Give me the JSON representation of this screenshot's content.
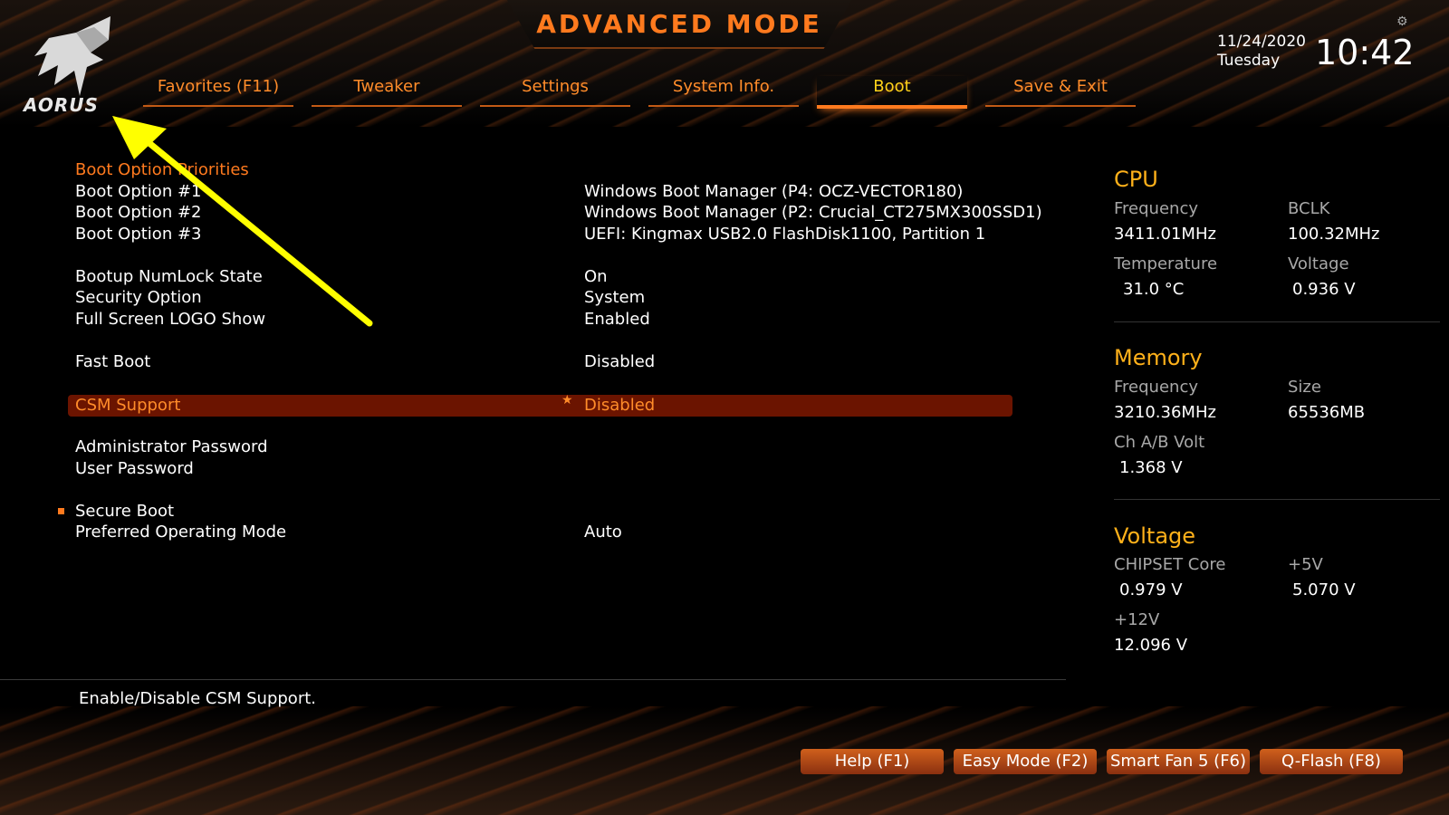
{
  "header": {
    "title": "ADVANCED MODE",
    "logo_text": "AORUS",
    "date": "11/24/2020",
    "day": "Tuesday",
    "time": "10:42"
  },
  "tabs": [
    {
      "label": "Favorites (F11)"
    },
    {
      "label": "Tweaker"
    },
    {
      "label": "Settings"
    },
    {
      "label": "System Info."
    },
    {
      "label": "Boot",
      "active": true
    },
    {
      "label": "Save & Exit"
    }
  ],
  "boot": {
    "priorities_header": "Boot Option Priorities",
    "options": [
      {
        "label": "Boot Option #1",
        "value": "Windows Boot Manager (P4: OCZ-VECTOR180)"
      },
      {
        "label": "Boot Option #2",
        "value": "Windows Boot Manager (P2: Crucial_CT275MX300SSD1)"
      },
      {
        "label": "Boot Option #3",
        "value": "UEFI: Kingmax USB2.0 FlashDisk1100, Partition 1"
      }
    ],
    "numlock": {
      "label": "Bootup NumLock State",
      "value": "On"
    },
    "security": {
      "label": "Security Option",
      "value": "System"
    },
    "logo": {
      "label": "Full Screen LOGO Show",
      "value": "Enabled"
    },
    "fastboot": {
      "label": "Fast Boot",
      "value": "Disabled"
    },
    "csm": {
      "label": "CSM Support",
      "value": "Disabled"
    },
    "admin_pw": {
      "label": "Administrator Password"
    },
    "user_pw": {
      "label": "User Password"
    },
    "secure_boot": {
      "label": "Secure Boot"
    },
    "preferred_os": {
      "label": "Preferred Operating Mode",
      "value": "Auto"
    }
  },
  "help_text": "Enable/Disable CSM Support.",
  "sidebar": {
    "cpu": {
      "title": "CPU",
      "freq_label": "Frequency",
      "freq": "3411.01MHz",
      "bclk_label": "BCLK",
      "bclk": "100.32MHz",
      "temp_label": "Temperature",
      "temp": "31.0 °C",
      "volt_label": "Voltage",
      "volt": "0.936 V"
    },
    "memory": {
      "title": "Memory",
      "freq_label": "Frequency",
      "freq": "3210.36MHz",
      "size_label": "Size",
      "size": "65536MB",
      "chab_label": "Ch A/B Volt",
      "chab": "1.368 V"
    },
    "voltage": {
      "title": "Voltage",
      "chipset_label": "CHIPSET Core",
      "chipset": "0.979 V",
      "p5v_label": "+5V",
      "p5v": "5.070 V",
      "p12v_label": "+12V",
      "p12v": "12.096 V"
    }
  },
  "footer": {
    "help": "Help (F1)",
    "easy": "Easy Mode (F2)",
    "fan": "Smart Fan 5 (F6)",
    "qflash": "Q-Flash (F8)"
  },
  "colors": {
    "accent": "#ff7a1e",
    "active_tab": "#ffd21a",
    "highlight_row": "#6b1400",
    "side_heading": "#ffb11a",
    "annotation_arrow": "#ffff00"
  }
}
